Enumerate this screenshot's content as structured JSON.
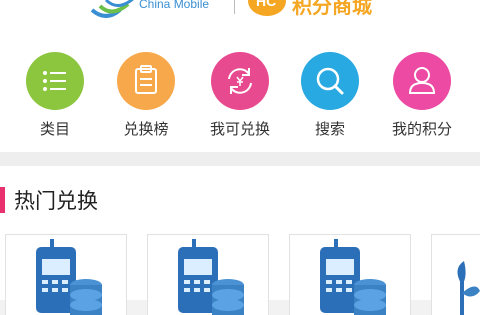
{
  "header": {
    "brand_text": "China Mobile",
    "promo_badge_text": "HC",
    "promo_text": "积分商城"
  },
  "nav": {
    "items": [
      {
        "label": "类目",
        "color": "#8cc63f",
        "icon": "list-icon"
      },
      {
        "label": "兑换榜",
        "color": "#f7a84a",
        "icon": "clipboard-icon"
      },
      {
        "label": "我可兑换",
        "color": "#e84a8f",
        "icon": "exchange-icon"
      },
      {
        "label": "搜索",
        "color": "#29a9e1",
        "icon": "search-icon"
      },
      {
        "label": "我的积分",
        "color": "#ec4aa3",
        "icon": "user-icon"
      }
    ]
  },
  "hot_section": {
    "title": "热门兑换",
    "accent_color": "#e8316e"
  },
  "products": [
    {
      "icon": "phone-coins-icon"
    },
    {
      "icon": "phone-coins-icon"
    },
    {
      "icon": "phone-coins-icon"
    },
    {
      "icon": "plant-icon"
    }
  ]
}
